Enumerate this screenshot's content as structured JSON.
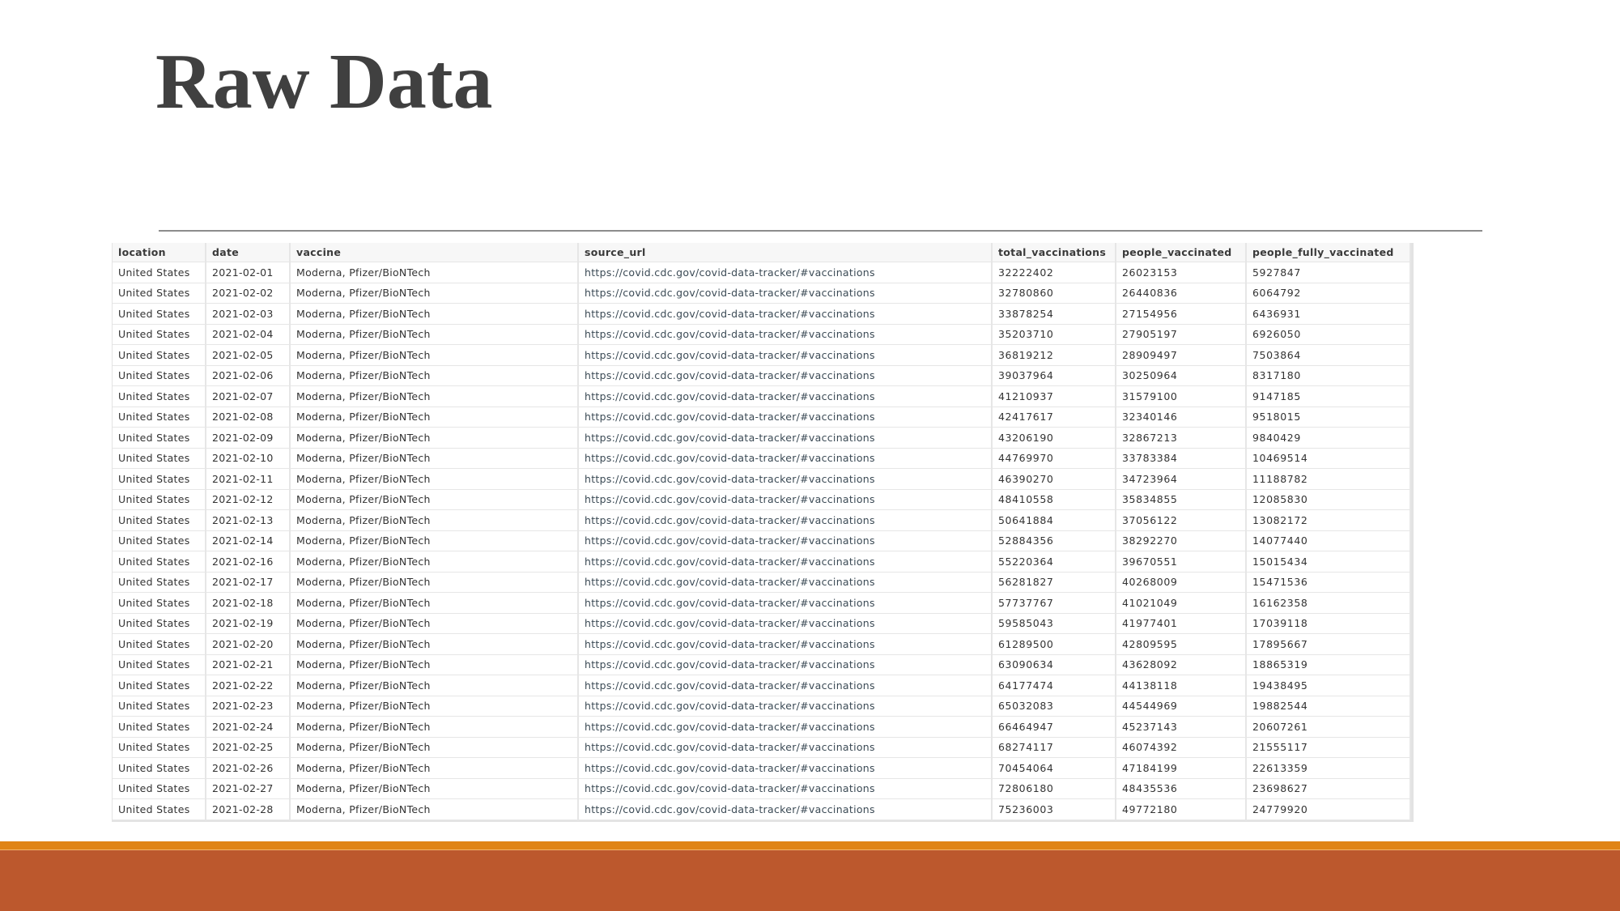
{
  "slide": {
    "title": "Raw Data",
    "colors": {
      "title": "#404040",
      "footer_strip": "#e08415",
      "footer_band": "#bc582d"
    }
  },
  "table": {
    "columns": [
      "location",
      "date",
      "vaccine",
      "source_url",
      "total_vaccinations",
      "people_vaccinated",
      "people_fully_vaccinated"
    ],
    "rows": [
      [
        "United States",
        "2021-02-01",
        "Moderna, Pfizer/BioNTech",
        "https://covid.cdc.gov/covid-data-tracker/#vaccinations",
        "32222402",
        "26023153",
        "5927847"
      ],
      [
        "United States",
        "2021-02-02",
        "Moderna, Pfizer/BioNTech",
        "https://covid.cdc.gov/covid-data-tracker/#vaccinations",
        "32780860",
        "26440836",
        "6064792"
      ],
      [
        "United States",
        "2021-02-03",
        "Moderna, Pfizer/BioNTech",
        "https://covid.cdc.gov/covid-data-tracker/#vaccinations",
        "33878254",
        "27154956",
        "6436931"
      ],
      [
        "United States",
        "2021-02-04",
        "Moderna, Pfizer/BioNTech",
        "https://covid.cdc.gov/covid-data-tracker/#vaccinations",
        "35203710",
        "27905197",
        "6926050"
      ],
      [
        "United States",
        "2021-02-05",
        "Moderna, Pfizer/BioNTech",
        "https://covid.cdc.gov/covid-data-tracker/#vaccinations",
        "36819212",
        "28909497",
        "7503864"
      ],
      [
        "United States",
        "2021-02-06",
        "Moderna, Pfizer/BioNTech",
        "https://covid.cdc.gov/covid-data-tracker/#vaccinations",
        "39037964",
        "30250964",
        "8317180"
      ],
      [
        "United States",
        "2021-02-07",
        "Moderna, Pfizer/BioNTech",
        "https://covid.cdc.gov/covid-data-tracker/#vaccinations",
        "41210937",
        "31579100",
        "9147185"
      ],
      [
        "United States",
        "2021-02-08",
        "Moderna, Pfizer/BioNTech",
        "https://covid.cdc.gov/covid-data-tracker/#vaccinations",
        "42417617",
        "32340146",
        "9518015"
      ],
      [
        "United States",
        "2021-02-09",
        "Moderna, Pfizer/BioNTech",
        "https://covid.cdc.gov/covid-data-tracker/#vaccinations",
        "43206190",
        "32867213",
        "9840429"
      ],
      [
        "United States",
        "2021-02-10",
        "Moderna, Pfizer/BioNTech",
        "https://covid.cdc.gov/covid-data-tracker/#vaccinations",
        "44769970",
        "33783384",
        "10469514"
      ],
      [
        "United States",
        "2021-02-11",
        "Moderna, Pfizer/BioNTech",
        "https://covid.cdc.gov/covid-data-tracker/#vaccinations",
        "46390270",
        "34723964",
        "11188782"
      ],
      [
        "United States",
        "2021-02-12",
        "Moderna, Pfizer/BioNTech",
        "https://covid.cdc.gov/covid-data-tracker/#vaccinations",
        "48410558",
        "35834855",
        "12085830"
      ],
      [
        "United States",
        "2021-02-13",
        "Moderna, Pfizer/BioNTech",
        "https://covid.cdc.gov/covid-data-tracker/#vaccinations",
        "50641884",
        "37056122",
        "13082172"
      ],
      [
        "United States",
        "2021-02-14",
        "Moderna, Pfizer/BioNTech",
        "https://covid.cdc.gov/covid-data-tracker/#vaccinations",
        "52884356",
        "38292270",
        "14077440"
      ],
      [
        "United States",
        "2021-02-16",
        "Moderna, Pfizer/BioNTech",
        "https://covid.cdc.gov/covid-data-tracker/#vaccinations",
        "55220364",
        "39670551",
        "15015434"
      ],
      [
        "United States",
        "2021-02-17",
        "Moderna, Pfizer/BioNTech",
        "https://covid.cdc.gov/covid-data-tracker/#vaccinations",
        "56281827",
        "40268009",
        "15471536"
      ],
      [
        "United States",
        "2021-02-18",
        "Moderna, Pfizer/BioNTech",
        "https://covid.cdc.gov/covid-data-tracker/#vaccinations",
        "57737767",
        "41021049",
        "16162358"
      ],
      [
        "United States",
        "2021-02-19",
        "Moderna, Pfizer/BioNTech",
        "https://covid.cdc.gov/covid-data-tracker/#vaccinations",
        "59585043",
        "41977401",
        "17039118"
      ],
      [
        "United States",
        "2021-02-20",
        "Moderna, Pfizer/BioNTech",
        "https://covid.cdc.gov/covid-data-tracker/#vaccinations",
        "61289500",
        "42809595",
        "17895667"
      ],
      [
        "United States",
        "2021-02-21",
        "Moderna, Pfizer/BioNTech",
        "https://covid.cdc.gov/covid-data-tracker/#vaccinations",
        "63090634",
        "43628092",
        "18865319"
      ],
      [
        "United States",
        "2021-02-22",
        "Moderna, Pfizer/BioNTech",
        "https://covid.cdc.gov/covid-data-tracker/#vaccinations",
        "64177474",
        "44138118",
        "19438495"
      ],
      [
        "United States",
        "2021-02-23",
        "Moderna, Pfizer/BioNTech",
        "https://covid.cdc.gov/covid-data-tracker/#vaccinations",
        "65032083",
        "44544969",
        "19882544"
      ],
      [
        "United States",
        "2021-02-24",
        "Moderna, Pfizer/BioNTech",
        "https://covid.cdc.gov/covid-data-tracker/#vaccinations",
        "66464947",
        "45237143",
        "20607261"
      ],
      [
        "United States",
        "2021-02-25",
        "Moderna, Pfizer/BioNTech",
        "https://covid.cdc.gov/covid-data-tracker/#vaccinations",
        "68274117",
        "46074392",
        "21555117"
      ],
      [
        "United States",
        "2021-02-26",
        "Moderna, Pfizer/BioNTech",
        "https://covid.cdc.gov/covid-data-tracker/#vaccinations",
        "70454064",
        "47184199",
        "22613359"
      ],
      [
        "United States",
        "2021-02-27",
        "Moderna, Pfizer/BioNTech",
        "https://covid.cdc.gov/covid-data-tracker/#vaccinations",
        "72806180",
        "48435536",
        "23698627"
      ],
      [
        "United States",
        "2021-02-28",
        "Moderna, Pfizer/BioNTech",
        "https://covid.cdc.gov/covid-data-tracker/#vaccinations",
        "75236003",
        "49772180",
        "24779920"
      ]
    ]
  }
}
